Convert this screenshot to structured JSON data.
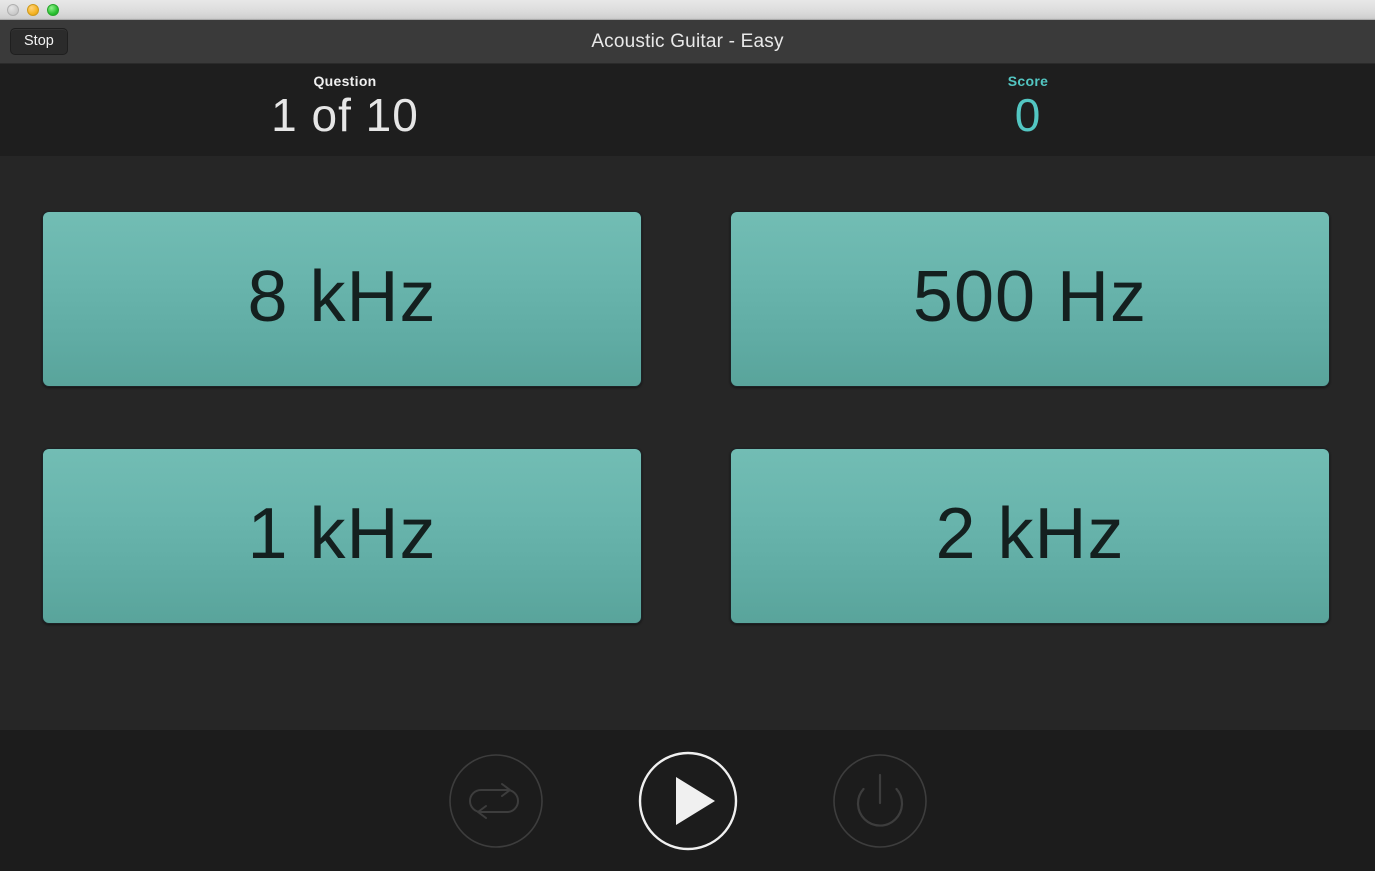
{
  "window": {
    "titlebar": {
      "close_label": "close",
      "minimize_label": "minimize",
      "maximize_label": "maximize"
    }
  },
  "toolbar": {
    "stop_label": "Stop",
    "title": "Acoustic Guitar - Easy"
  },
  "status": {
    "question": {
      "label": "Question",
      "value": "1 of 10",
      "current": 1,
      "total": 10
    },
    "score": {
      "label": "Score",
      "value": "0",
      "color": "#53c6c2"
    }
  },
  "answers": {
    "accent_top": "#72bdb4",
    "accent_bottom": "#59a49b",
    "options": [
      {
        "label": "8 kHz"
      },
      {
        "label": "500 Hz"
      },
      {
        "label": "1 kHz"
      },
      {
        "label": "2 kHz"
      }
    ]
  },
  "transport": {
    "loop": {
      "icon": "loop-icon",
      "label": "Loop"
    },
    "play": {
      "icon": "play-icon",
      "label": "Play"
    },
    "power": {
      "icon": "power-icon",
      "label": "Power"
    }
  }
}
